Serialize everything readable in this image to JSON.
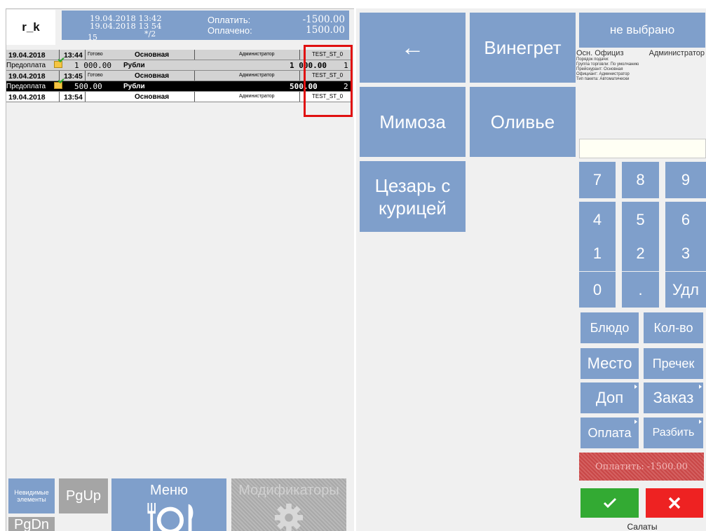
{
  "header": {
    "logo": "r_k",
    "date_open": "19.04.2018 13:42",
    "date_now": "19.04.2018 13 54",
    "guests": "15",
    "table": "*/2",
    "to_pay_label": "Оплатить:",
    "to_pay_value": "-1500.00",
    "paid_label": "Оплачено:",
    "paid_value": "1500.00"
  },
  "orders": [
    {
      "type": "header",
      "date": "19.04.2018",
      "time": "13:44",
      "status": "Готово",
      "hall": "Основная",
      "waiter": "Администратор",
      "station": "TEST_ST_0"
    },
    {
      "type": "payment",
      "label": "Предоплата",
      "amount": "1 000.00",
      "currency": "Рубли",
      "total": "1 000.00",
      "qty": "1"
    },
    {
      "type": "header",
      "date": "19.04.2018",
      "time": "13:45",
      "status": "Готово",
      "hall": "Основная",
      "waiter": "Администратор",
      "station": "TEST_ST_0"
    },
    {
      "type": "payment_selected",
      "label": "Предоплата",
      "amount": "500.00",
      "currency": "Рубли",
      "total": "500.00",
      "qty": "2"
    },
    {
      "type": "header_white",
      "date": "19.04.2018",
      "time": "13:54",
      "status": "",
      "hall": "Основная",
      "waiter": "Администратор",
      "station": "TEST_ST_0"
    }
  ],
  "bottom": {
    "invisible": "Невидимые элементы",
    "pgup": "PgUp",
    "pgdn": "PgDn",
    "menu": "Меню",
    "modifiers": "Модификаторы"
  },
  "dishes": {
    "back": "←",
    "vinegret": "Винегрет",
    "mimosa": "Мимоза",
    "olivie": "Оливье",
    "caesar": "Цезарь с курицей"
  },
  "right": {
    "not_selected": "не выбрано",
    "main_waiter": "Осн. Официз",
    "admin": "Администратор",
    "serve_order": "Порядок подачи:",
    "trade_group": "Группа торговли: По умолчанию",
    "price_list": "Прейскурант: Основная",
    "waiter": "Официант: Администратор",
    "package_type": "Тип пакета: Автоматически",
    "keys": [
      "7",
      "8",
      "9",
      "4",
      "5",
      "6",
      "1",
      "2",
      "3",
      "0",
      ".",
      "Удл"
    ],
    "dish": "Блюдо",
    "qty": "Кол-во",
    "place": "Место",
    "precheck": "Пречек",
    "extra": "Доп",
    "order": "Заказ",
    "payment": "Оплата",
    "split": "Разбить",
    "pay_btn": "Оплатить: -1500.00",
    "category": "Салаты"
  },
  "colors": {
    "button": "#7f9fcb",
    "disabled": "#a5a5a5",
    "ok": "#33aa33",
    "cancel": "#ee2222",
    "highlight": "#e01010"
  }
}
